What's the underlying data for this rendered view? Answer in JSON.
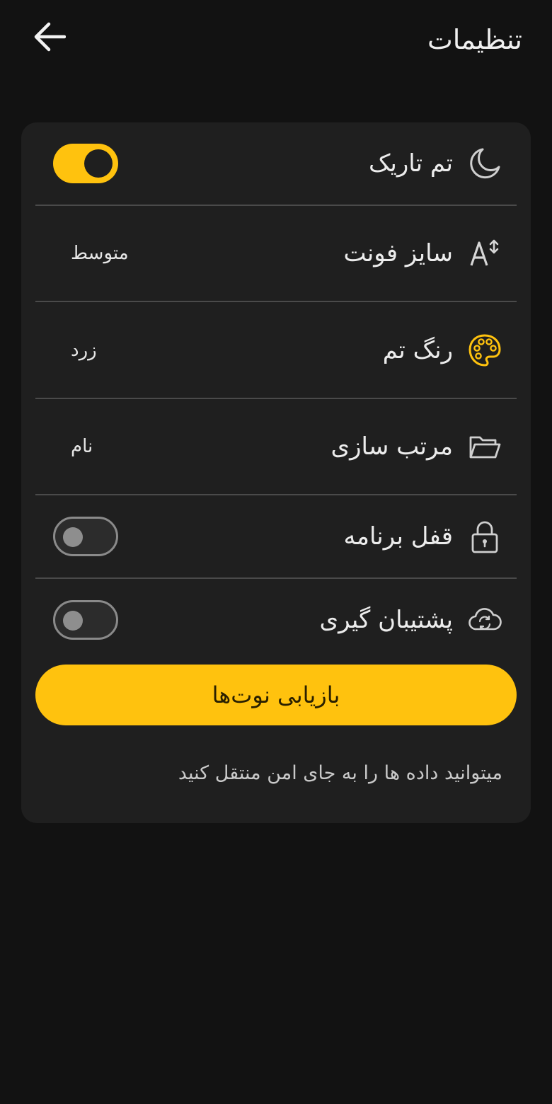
{
  "header": {
    "title": "تنظیمات",
    "back_icon": "arrow-left-icon"
  },
  "settings": {
    "dark_theme": {
      "label": "تم تاریک",
      "icon": "moon-icon",
      "enabled": true
    },
    "font_size": {
      "label": "سایز فونت",
      "icon": "font-size-icon",
      "value": "متوسط"
    },
    "theme_color": {
      "label": "رنگ تم",
      "icon": "palette-icon",
      "value": "زرد"
    },
    "sort": {
      "label": "مرتب سازی",
      "icon": "folder-icon",
      "value": "نام"
    },
    "app_lock": {
      "label": "قفل برنامه",
      "icon": "lock-icon",
      "enabled": false
    },
    "backup": {
      "label": "پشتیبان گیری",
      "icon": "cloud-sync-icon",
      "enabled": false
    }
  },
  "restore_button": {
    "label": "بازیابی نوت‌ها"
  },
  "footnote": "میتوانید داده ها را به جای امن منتقل کنید",
  "colors": {
    "background": "#121212",
    "card": "#1f1f1f",
    "accent": "#ffc20e",
    "divider": "#4a4a4a"
  }
}
